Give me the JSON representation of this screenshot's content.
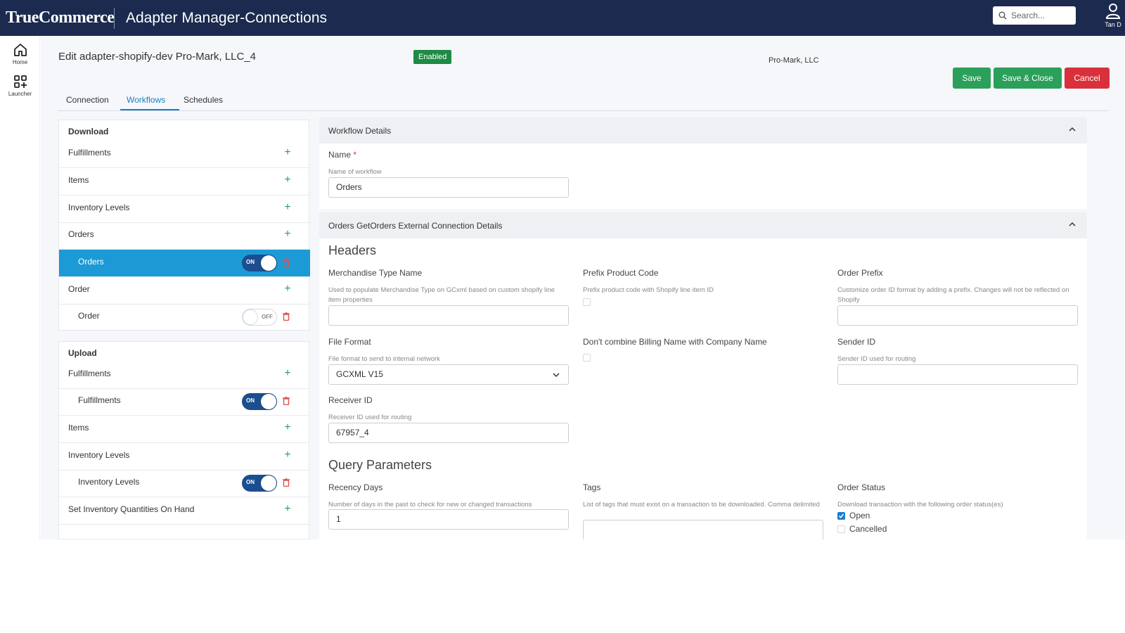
{
  "header": {
    "brand": "TrueCommerce",
    "app_title": "Adapter Manager-Connections",
    "search_placeholder": "Search...",
    "user_name": "Tan D"
  },
  "rail": {
    "home_label": "Home",
    "launcher_label": "Launcher"
  },
  "page": {
    "edit_title": "Edit adapter-shopify-dev Pro-Mark, LLC_4",
    "status_badge": "Enabled",
    "customer": "Pro-Mark, LLC",
    "save_label": "Save",
    "save_close_label": "Save & Close",
    "cancel_label": "Cancel",
    "tabs": [
      {
        "label": "Connection",
        "active": false
      },
      {
        "label": "Workflows",
        "active": true
      },
      {
        "label": "Schedules",
        "active": false
      }
    ]
  },
  "download": {
    "title": "Download",
    "rows": [
      {
        "label": "Fulfillments",
        "type": "group"
      },
      {
        "label": "Items",
        "type": "group"
      },
      {
        "label": "Inventory Levels",
        "type": "group"
      },
      {
        "label": "Orders",
        "type": "group"
      },
      {
        "label": "Orders",
        "type": "workflow",
        "toggle": "ON",
        "selected": true
      },
      {
        "label": "Order",
        "type": "group"
      },
      {
        "label": "Order",
        "type": "workflow",
        "toggle": "OFF",
        "selected": false
      }
    ]
  },
  "upload": {
    "title": "Upload",
    "rows": [
      {
        "label": "Fulfillments",
        "type": "group"
      },
      {
        "label": "Fulfillments",
        "type": "workflow",
        "toggle": "ON"
      },
      {
        "label": "Items",
        "type": "group"
      },
      {
        "label": "Inventory Levels",
        "type": "group"
      },
      {
        "label": "Inventory Levels",
        "type": "workflow",
        "toggle": "ON"
      },
      {
        "label": "Set Inventory Quantities On Hand",
        "type": "group"
      }
    ]
  },
  "workflow_details": {
    "title": "Workflow Details",
    "name_label": "Name",
    "name_required": "*",
    "name_hint": "Name of workflow",
    "name_value": "Orders"
  },
  "connection_details": {
    "title": "Orders GetOrders External Connection Details",
    "headers_title": "Headers",
    "merchandise_label": "Merchandise Type Name",
    "merchandise_hint": "Used to populate Merchandise Type on GCxml based on custom shopify line item properties",
    "merchandise_value": "",
    "prefix_label": "Prefix Product Code",
    "prefix_hint": "Prefix product code with Shopify line item ID",
    "prefix_checked": false,
    "order_prefix_label": "Order Prefix",
    "order_prefix_hint": "Customize order ID format by adding a prefix. Changes will not be reflected on Shopify",
    "order_prefix_value": "",
    "file_format_label": "File Format",
    "file_format_hint": "File format to send to internal network",
    "file_format_value": "GCXML V15",
    "billing_label": "Don't combine Billing Name with Company Name",
    "billing_checked": false,
    "sender_label": "Sender ID",
    "sender_hint": "Sender ID used for routing",
    "sender_value": "",
    "receiver_label": "Receiver ID",
    "receiver_hint": "Receiver ID used for routing",
    "receiver_value": "67957_4",
    "query_title": "Query Parameters",
    "recency_label": "Recency Days",
    "recency_hint": "Number of days in the past to check for new or changed transactions",
    "recency_value": "1",
    "tags_label": "Tags",
    "tags_hint": "List of tags that must exist on a transaction to be downloaded. Comma delimited",
    "tags_value": "",
    "status_label": "Order Status",
    "status_hint": "Download transaction with the following order status(es)",
    "status_options": [
      {
        "label": "Open",
        "checked": true
      },
      {
        "label": "Cancelled",
        "checked": false
      }
    ]
  },
  "colors": {
    "topbar": "#1b2a4e",
    "accent": "#1a7fc0",
    "selected_row": "#1c9ad6",
    "save_green": "#2aa05a",
    "cancel_red": "#d9303b",
    "toggle_on": "#1b4e8f"
  }
}
